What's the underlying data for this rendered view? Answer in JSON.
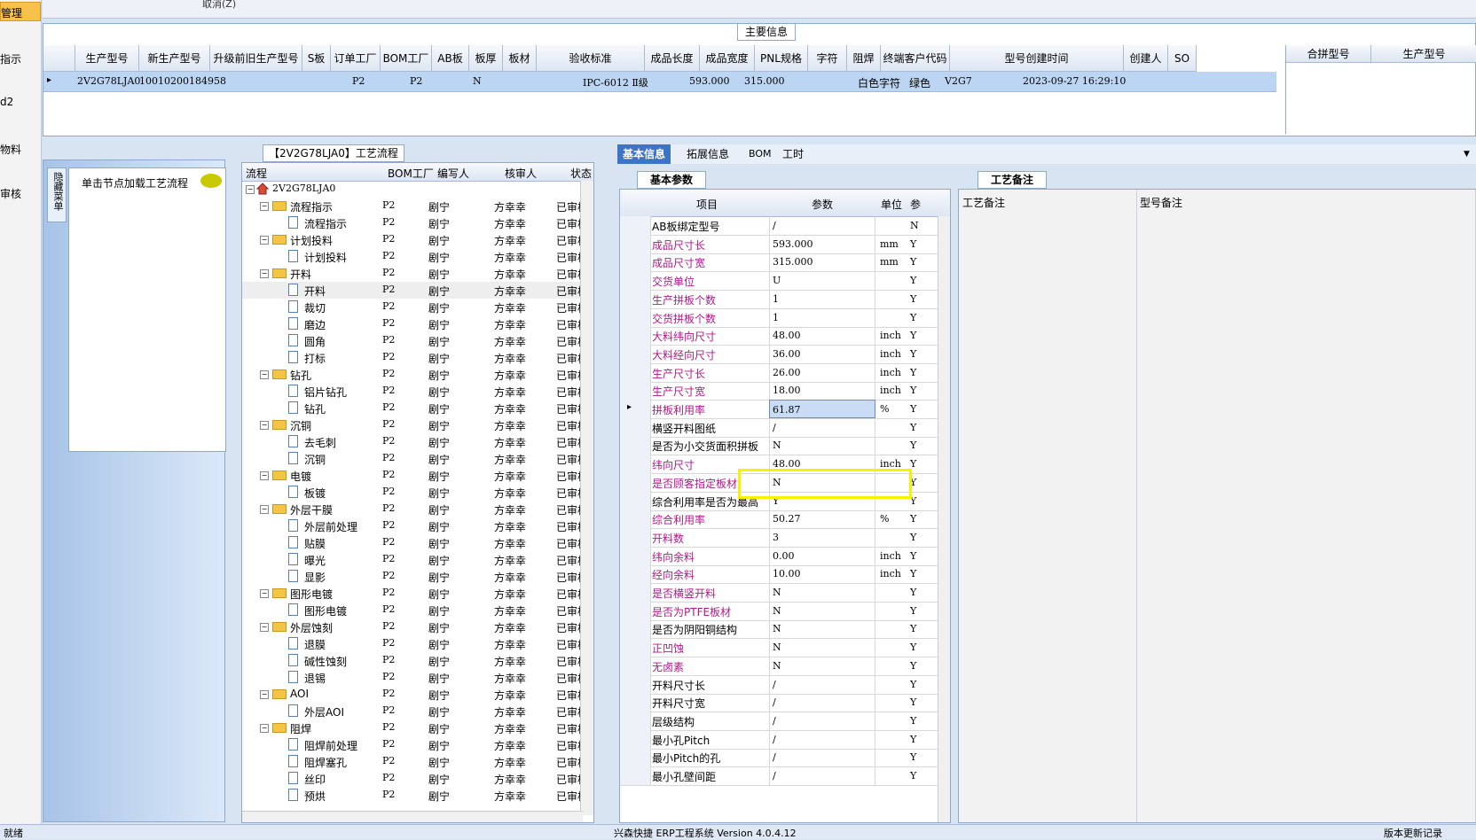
{
  "left_nav": {
    "selected_label": "管理",
    "items": [
      "指示",
      "d2",
      "物料",
      "审核"
    ]
  },
  "top_strip": {
    "cancel_label": "取消(Z)"
  },
  "main_info": {
    "caption": "主要信息",
    "columns": [
      "生产型号",
      "新生产型号",
      "升级前旧生产型号",
      "S板",
      "订单工厂",
      "BOM工厂",
      "AB板",
      "板厚",
      "板材",
      "验收标准",
      "成品长度",
      "成品宽度",
      "PNL规格",
      "字符",
      "阻焊",
      "终端客户代码",
      "型号创建时间",
      "创建人",
      "SO"
    ],
    "row": {
      "prod_no": "2V2G78LJA0",
      "new_prod_no": "10010200184958",
      "order_factory": "P2",
      "bom_factory": "P2",
      "ab": "N",
      "standard": "IPC-6012 Ⅱ级",
      "length": "593.000",
      "width": "315.000",
      "char": "白色字符",
      "mask": "绿色",
      "customer": "V2G7",
      "created": "2023-09-27 16:29:10"
    },
    "side_columns": [
      "合拼型号",
      "生产型号"
    ]
  },
  "left_panel": {
    "tab_label": "隐藏菜单",
    "hint": "单击节点加载工艺流程"
  },
  "tree": {
    "caption": "【2V2G78LJA0】工艺流程",
    "headers": [
      "流程",
      "BOM工厂",
      "编写人",
      "核审人",
      "状态"
    ],
    "root": "2V2G78LJA0",
    "bom": "P2",
    "writer": "剧宁",
    "reviewer": "方幸幸",
    "status": "已审核",
    "nodes": [
      {
        "label": "流程指示",
        "level": 1
      },
      {
        "label": "流程指示",
        "level": 2
      },
      {
        "label": "计划投料",
        "level": 1
      },
      {
        "label": "计划投料",
        "level": 2
      },
      {
        "label": "开料",
        "level": 1
      },
      {
        "label": "开料",
        "level": 2
      },
      {
        "label": "裁切",
        "level": 2
      },
      {
        "label": "磨边",
        "level": 2
      },
      {
        "label": "圆角",
        "level": 2
      },
      {
        "label": "打标",
        "level": 2
      },
      {
        "label": "钻孔",
        "level": 1
      },
      {
        "label": "铝片钻孔",
        "level": 2
      },
      {
        "label": "钻孔",
        "level": 2
      },
      {
        "label": "沉铜",
        "level": 1
      },
      {
        "label": "去毛刺",
        "level": 2
      },
      {
        "label": "沉铜",
        "level": 2
      },
      {
        "label": "电镀",
        "level": 1
      },
      {
        "label": "板镀",
        "level": 2
      },
      {
        "label": "外层干膜",
        "level": 1
      },
      {
        "label": "外层前处理",
        "level": 2
      },
      {
        "label": "贴膜",
        "level": 2
      },
      {
        "label": "曝光",
        "level": 2
      },
      {
        "label": "显影",
        "level": 2
      },
      {
        "label": "图形电镀",
        "level": 1
      },
      {
        "label": "图形电镀",
        "level": 2
      },
      {
        "label": "外层蚀刻",
        "level": 1
      },
      {
        "label": "退膜",
        "level": 2
      },
      {
        "label": "碱性蚀刻",
        "level": 2
      },
      {
        "label": "退锡",
        "level": 2
      },
      {
        "label": "AOI",
        "level": 1
      },
      {
        "label": "外层AOI",
        "level": 2
      },
      {
        "label": "阻焊",
        "level": 1
      },
      {
        "label": "阻焊前处理",
        "level": 2
      },
      {
        "label": "阻焊塞孔",
        "level": 2
      },
      {
        "label": "丝印",
        "level": 2
      },
      {
        "label": "预烘",
        "level": 2
      }
    ]
  },
  "tabs": [
    "基本信息",
    "拓展信息",
    "BOM",
    "工时"
  ],
  "params": {
    "caption": "基本参数",
    "headers": [
      "项目",
      "参数",
      "单位",
      "参"
    ],
    "rows": [
      {
        "name": "AB板绑定型号",
        "value": "/",
        "unit": "",
        "req": "N",
        "hl": false
      },
      {
        "name": "成品尺寸长",
        "value": "593.000",
        "unit": "mm",
        "req": "Y",
        "hl": true
      },
      {
        "name": "成品尺寸宽",
        "value": "315.000",
        "unit": "mm",
        "req": "Y",
        "hl": true
      },
      {
        "name": "交货单位",
        "value": "U",
        "unit": "",
        "req": "Y",
        "hl": true
      },
      {
        "name": "生产拼板个数",
        "value": "1",
        "unit": "",
        "req": "Y",
        "hl": true
      },
      {
        "name": "交货拼板个数",
        "value": "1",
        "unit": "",
        "req": "Y",
        "hl": true
      },
      {
        "name": "大料纬向尺寸",
        "value": "48.00",
        "unit": "inch",
        "req": "Y",
        "hl": true
      },
      {
        "name": "大料经向尺寸",
        "value": "36.00",
        "unit": "inch",
        "req": "Y",
        "hl": true
      },
      {
        "name": "生产尺寸长",
        "value": "26.00",
        "unit": "inch",
        "req": "Y",
        "hl": true
      },
      {
        "name": "生产尺寸宽",
        "value": "18.00",
        "unit": "inch",
        "req": "Y",
        "hl": true
      },
      {
        "name": "拼板利用率",
        "value": "61.87",
        "unit": "%",
        "req": "Y",
        "hl": true,
        "current": true
      },
      {
        "name": "横竖开料图纸",
        "value": "/",
        "unit": "",
        "req": "Y",
        "hl": false
      },
      {
        "name": "是否为小交货面积拼板",
        "value": "N",
        "unit": "",
        "req": "Y",
        "hl": false
      },
      {
        "name": "纬向尺寸",
        "value": "48.00",
        "unit": "inch",
        "req": "Y",
        "hl": true
      },
      {
        "name": "是否顾客指定板材",
        "value": "N",
        "unit": "",
        "req": "Y",
        "hl": true
      },
      {
        "name": "综合利用率是否为最高",
        "value": "Y",
        "unit": "",
        "req": "Y",
        "hl": false
      },
      {
        "name": "综合利用率",
        "value": "50.27",
        "unit": "%",
        "req": "Y",
        "hl": true
      },
      {
        "name": "开料数",
        "value": "3",
        "unit": "",
        "req": "Y",
        "hl": true
      },
      {
        "name": "纬向余料",
        "value": "0.00",
        "unit": "inch",
        "req": "Y",
        "hl": true
      },
      {
        "name": "经向余料",
        "value": "10.00",
        "unit": "inch",
        "req": "Y",
        "hl": true
      },
      {
        "name": "是否横竖开料",
        "value": "N",
        "unit": "",
        "req": "Y",
        "hl": true
      },
      {
        "name": "是否为PTFE板材",
        "value": "N",
        "unit": "",
        "req": "Y",
        "hl": true
      },
      {
        "name": "是否为阴阳铜结构",
        "value": "N",
        "unit": "",
        "req": "Y",
        "hl": false
      },
      {
        "name": "正凹蚀",
        "value": "N",
        "unit": "",
        "req": "Y",
        "hl": true
      },
      {
        "name": "无卤素",
        "value": "N",
        "unit": "",
        "req": "Y",
        "hl": true
      },
      {
        "name": "开料尺寸长",
        "value": "/",
        "unit": "",
        "req": "Y",
        "hl": false
      },
      {
        "name": "开料尺寸宽",
        "value": "/",
        "unit": "",
        "req": "Y",
        "hl": false
      },
      {
        "name": "层级结构",
        "value": "/",
        "unit": "",
        "req": "Y",
        "hl": false
      },
      {
        "name": "最小孔Pitch",
        "value": "/",
        "unit": "",
        "req": "Y",
        "hl": false
      },
      {
        "name": "最小Pitch的孔",
        "value": "/",
        "unit": "",
        "req": "Y",
        "hl": false
      },
      {
        "name": "最小孔壁间距",
        "value": "/",
        "unit": "",
        "req": "Y",
        "hl": false
      }
    ]
  },
  "notes": {
    "caption": "工艺备注",
    "col1": "工艺备注",
    "col2": "型号备注"
  },
  "status": {
    "left": "就绪",
    "center": "兴森快捷 ERP工程系统 Version 4.0.4.12",
    "right": "版本更新记录"
  },
  "colors": {
    "accent": "#3d74c6",
    "highlight_border": "#f5f300",
    "param_highlight_text": "#b0198a",
    "selected_row": "#bcd5f2"
  }
}
